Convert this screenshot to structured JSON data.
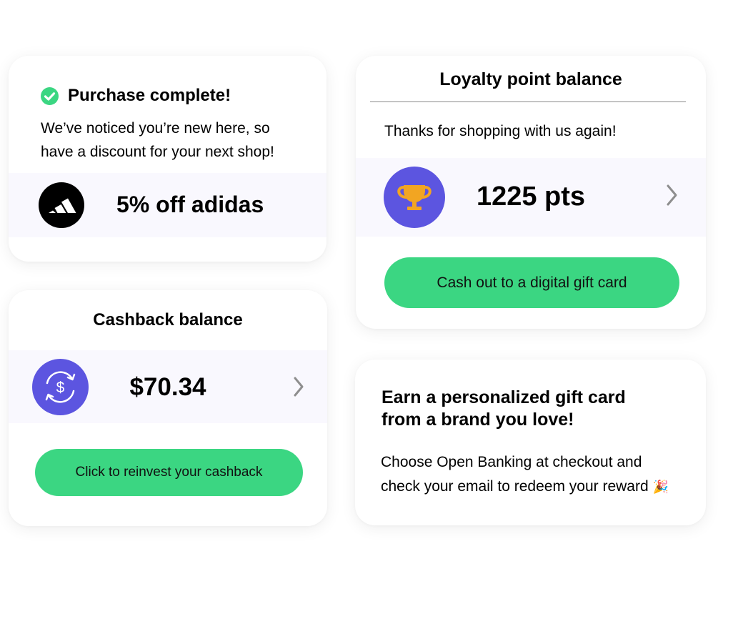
{
  "purchase": {
    "title": "Purchase complete!",
    "message_line1": "We’ve noticed you’re new here, so",
    "message_line2": "have a discount for your next shop!",
    "offer_label": "5% off adidas"
  },
  "loyalty": {
    "title": "Loyalty point balance",
    "subtitle": "Thanks for shopping with us again!",
    "points": "1225 pts",
    "cta_label": "Cash out to a digital gift card"
  },
  "cashback": {
    "title": "Cashback balance",
    "amount": "$70.34",
    "cta_label": "Click to reinvest your cashback"
  },
  "giftcard": {
    "heading_line1": "Earn a personalized gift card",
    "heading_line2": "from a brand you love!",
    "body_line1": "Choose Open Banking at checkout and",
    "body_line2": "check your email to redeem your reward",
    "emoji": "🎉"
  },
  "colors": {
    "accent_green": "#3bd682",
    "check_green": "#3bd682",
    "icon_purple": "#5c55e0",
    "trophy_gold": "#f2a522",
    "band_bg": "#f9f8fe"
  },
  "icons": {
    "check": "check-circle-icon",
    "brand_logo": "adidas-logo",
    "trophy": "trophy-icon",
    "cashback": "refresh-dollar-icon",
    "chevron": "chevron-right-icon"
  }
}
